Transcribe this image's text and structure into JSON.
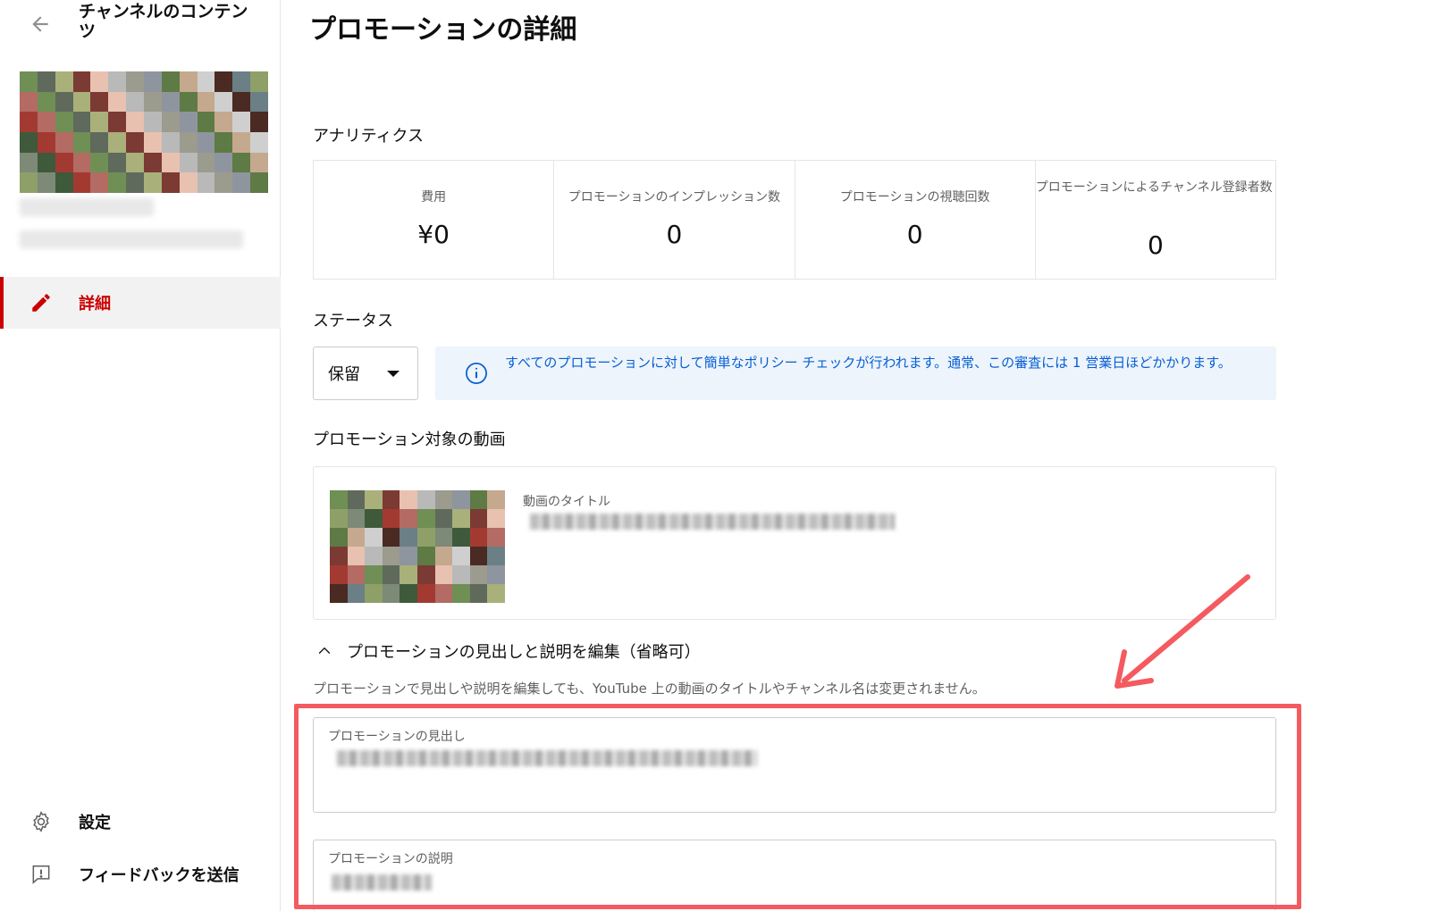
{
  "sidebar": {
    "channel_title": "チャンネルのコンテンツ",
    "nav_details": "詳細",
    "nav_settings": "設定",
    "nav_feedback": "フィードバックを送信"
  },
  "main": {
    "title": "プロモーションの詳細",
    "analytics": {
      "heading": "アナリティクス",
      "metrics": [
        {
          "label": "費用",
          "value": "¥0"
        },
        {
          "label": "プロモーションのインプレッション数",
          "value": "0"
        },
        {
          "label": "プロモーションの視聴回数",
          "value": "0"
        },
        {
          "label": "プロモーションによるチャンネル登録者数",
          "value": "0"
        }
      ]
    },
    "status": {
      "heading": "ステータス",
      "selected": "保留",
      "info": "すべてのプロモーションに対して簡単なポリシー チェックが行われます。通常、この審査には 1 営業日ほどかかります。"
    },
    "video": {
      "heading": "プロモーション対象の動画",
      "title_label": "動画のタイトル"
    },
    "edit": {
      "toggle_label": "プロモーションの見出しと説明を編集（省略可）",
      "helper": "プロモーションで見出しや説明を編集しても、YouTube 上の動画のタイトルやチャンネル名は変更されません。",
      "headline_label": "プロモーションの見出し",
      "description_label": "プロモーションの説明"
    }
  },
  "colors": {
    "accent_red": "#cc0000",
    "info_blue": "#065fd4",
    "info_bg": "#eef4fb",
    "annotation": "#f45a5f"
  },
  "icons": [
    "back-arrow-icon",
    "pencil-icon",
    "gear-icon",
    "feedback-icon",
    "info-icon",
    "chevron-up-icon",
    "caret-down-icon"
  ]
}
